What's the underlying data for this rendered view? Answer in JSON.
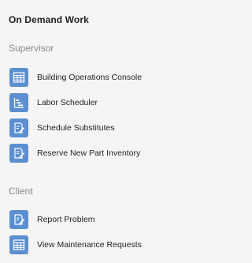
{
  "panel": {
    "title": "On Demand Work"
  },
  "sections": [
    {
      "label": "Supervisor",
      "items": [
        {
          "label": "Building Operations Console",
          "icon": "table-grid-icon"
        },
        {
          "label": "Labor Scheduler",
          "icon": "gantt-chart-icon"
        },
        {
          "label": "Schedule Substitutes",
          "icon": "edit-form-icon"
        },
        {
          "label": "Reserve New Part Inventory",
          "icon": "edit-form-icon"
        }
      ]
    },
    {
      "label": "Client",
      "items": [
        {
          "label": "Report Problem",
          "icon": "edit-form-icon"
        },
        {
          "label": "View Maintenance Requests",
          "icon": "table-grid-icon"
        }
      ]
    }
  ],
  "colors": {
    "icon_background": "#5b8fcf",
    "section_label": "#8a8a8a",
    "panel_background": "#f5f5f5"
  }
}
